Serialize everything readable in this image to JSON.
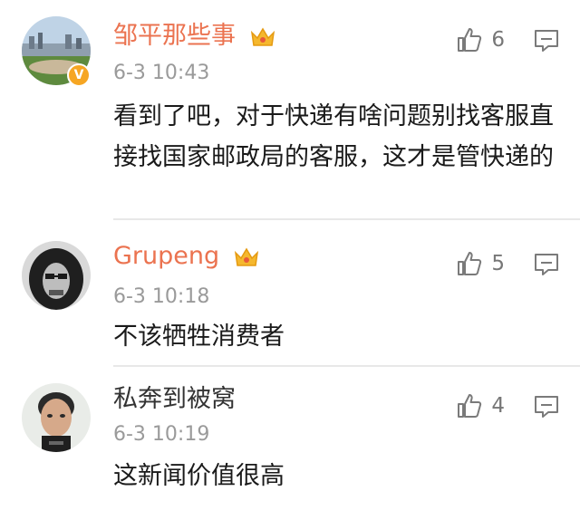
{
  "comments": [
    {
      "username": "邹平那些事",
      "time": "6-3 10:43",
      "text": "看到了吧，对于快递有啥问题别找客服直接找国家邮政局的客服，这才是管快递的",
      "likes": "6",
      "vip": true,
      "verified": true
    },
    {
      "username": "Grupeng",
      "time": "6-3 10:18",
      "text": "不该牺牲消费者",
      "likes": "5",
      "vip": true,
      "verified": false
    },
    {
      "username": "私奔到被窝",
      "time": "6-3 10:19",
      "text": "这新闻价值很高",
      "likes": "4",
      "vip": false,
      "verified": false
    }
  ],
  "colors": {
    "vip_name": "#eb7350",
    "plain_name": "#333333",
    "time": "#9a9a9a",
    "icon": "#7a7a7a"
  },
  "icons": {
    "like": "thumbs-up-icon",
    "reply": "comment-icon",
    "vip": "crown-icon",
    "verified": "verified-v-icon"
  }
}
